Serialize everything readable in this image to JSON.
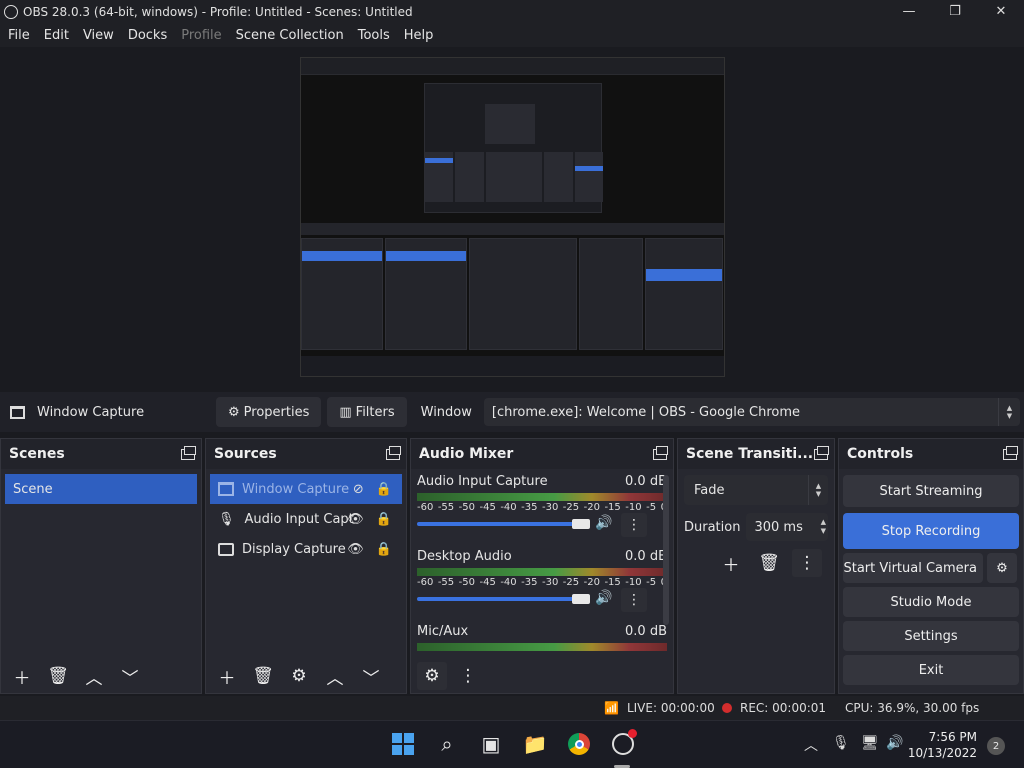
{
  "window": {
    "title": "OBS 28.0.3 (64-bit, windows) - Profile: Untitled - Scenes: Untitled",
    "minimize": "—",
    "maximize": "❐",
    "close": "✕"
  },
  "menu": [
    "File",
    "Edit",
    "View",
    "Docks",
    "Profile",
    "Scene Collection",
    "Tools",
    "Help"
  ],
  "source_toolbar": {
    "source_name": "Window Capture",
    "properties_label": "Properties",
    "filters_label": "Filters",
    "window_label": "Window",
    "window_value": "[chrome.exe]: Welcome | OBS - Google Chrome"
  },
  "scenes": {
    "title": "Scenes",
    "items": [
      "Scene"
    ]
  },
  "sources": {
    "title": "Sources",
    "items": [
      "Window Capture",
      "Audio Input Capt",
      "Display Capture"
    ]
  },
  "audio_mixer": {
    "title": "Audio Mixer",
    "scale": [
      "-60",
      "-55",
      "-50",
      "-45",
      "-40",
      "-35",
      "-30",
      "-25",
      "-20",
      "-15",
      "-10",
      "-5",
      "0"
    ],
    "channels": [
      {
        "name": "Audio Input Capture",
        "level": "0.0 dB"
      },
      {
        "name": "Desktop Audio",
        "level": "0.0 dB"
      },
      {
        "name": "Mic/Aux",
        "level": "0.0 dB"
      }
    ]
  },
  "transitions": {
    "title": "Scene Transiti...",
    "selected": "Fade",
    "duration_label": "Duration",
    "duration_value": "300 ms"
  },
  "controls": {
    "title": "Controls",
    "start_streaming": "Start Streaming",
    "stop_recording": "Stop Recording",
    "start_virtual_camera": "Start Virtual Camera",
    "studio_mode": "Studio Mode",
    "settings": "Settings",
    "exit": "Exit"
  },
  "status": {
    "live": "LIVE: 00:00:00",
    "rec": "REC: 00:00:01",
    "cpu": "CPU: 36.9%, 30.00 fps"
  },
  "taskbar": {
    "time": "7:56 PM",
    "date": "10/13/2022",
    "notifications": "2"
  },
  "colors": {
    "accent": "#3a6fd8",
    "rec": "#d32d2d"
  }
}
